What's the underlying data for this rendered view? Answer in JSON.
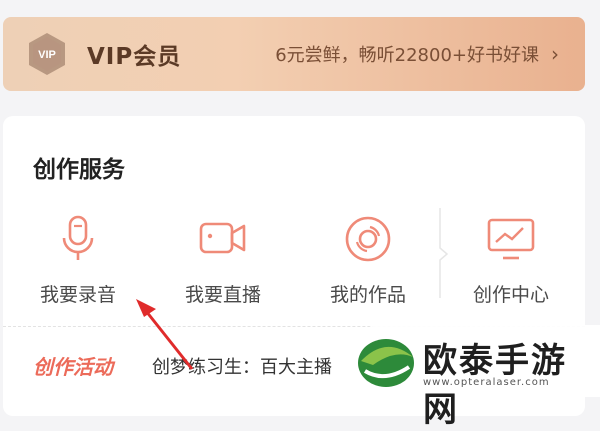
{
  "vip": {
    "badge_text": "VIP",
    "title": "VIP会员",
    "promo": "6元尝鲜，畅听22800+好书好课",
    "chevron": "›"
  },
  "creation": {
    "title": "创作服务",
    "items": [
      {
        "label": "我要录音",
        "icon": "microphone-icon"
      },
      {
        "label": "我要直播",
        "icon": "video-camera-icon"
      },
      {
        "label": "我的作品",
        "icon": "disc-icon"
      },
      {
        "label": "创作中心",
        "icon": "monitor-chart-icon"
      }
    ]
  },
  "activity": {
    "tag": "创作活动",
    "text": "创梦练习生：百大主播"
  },
  "watermark": {
    "name": "欧泰手游网",
    "url": "www.opteralaser.com"
  },
  "colors": {
    "accent": "#ec6b5a",
    "vip_text": "#5b3a26"
  }
}
